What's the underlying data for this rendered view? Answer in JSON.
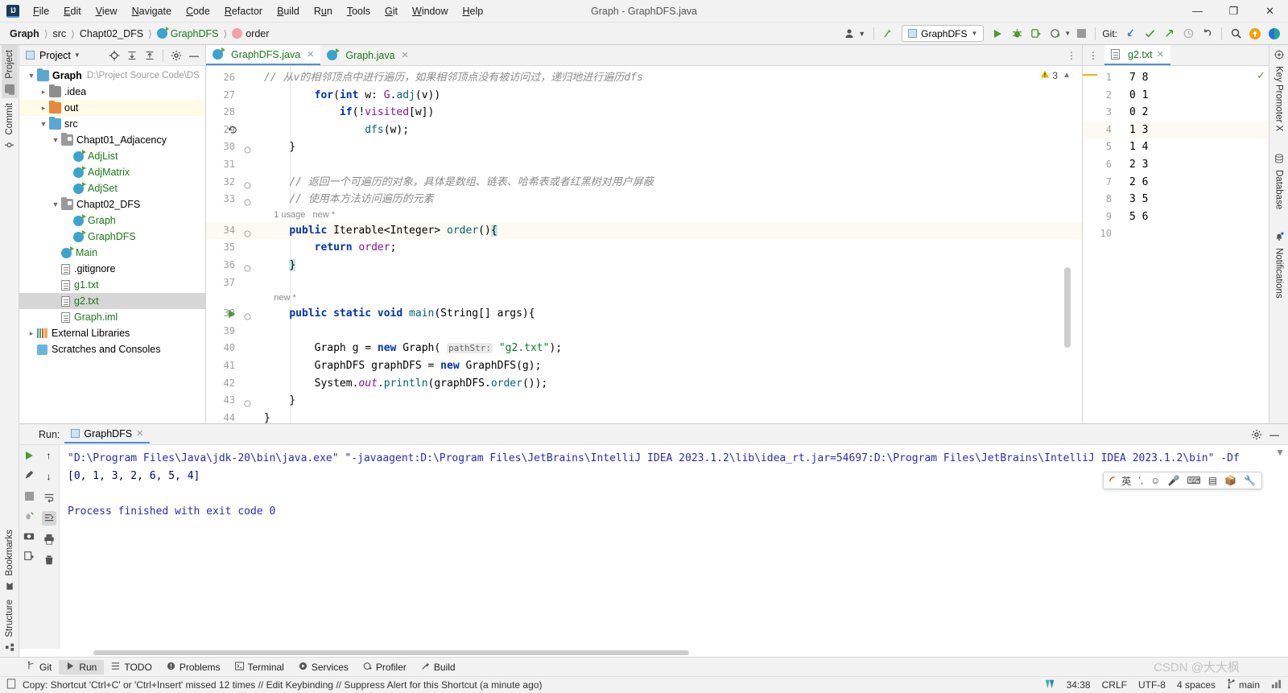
{
  "window": {
    "title": "Graph - GraphDFS.java",
    "logo": "IJ",
    "min": "—",
    "max": "❐",
    "close": "✕"
  },
  "menu": [
    "File",
    "Edit",
    "View",
    "Navigate",
    "Code",
    "Refactor",
    "Build",
    "Run",
    "Tools",
    "Git",
    "Window",
    "Help"
  ],
  "breadcrumb": [
    {
      "label": "Graph",
      "kind": "project"
    },
    {
      "label": "src",
      "kind": "dir"
    },
    {
      "label": "Chapt02_DFS",
      "kind": "dir"
    },
    {
      "label": "GraphDFS",
      "kind": "class"
    },
    {
      "label": "order",
      "kind": "method"
    }
  ],
  "toolbar": {
    "run_config": "GraphDFS",
    "git_label": "Git:",
    "icons": [
      "avatar-icon",
      "undo-arrow-icon",
      "run-icon",
      "debug-icon",
      "run-coverage-icon",
      "profile-icon",
      "stop-icon",
      "git-update-icon",
      "git-commit-icon",
      "git-push-icon",
      "git-history-icon",
      "git-rollback-icon",
      "search-everywhere-icon",
      "updates-icon",
      "ide-icon"
    ]
  },
  "left_strip": {
    "tabs": [
      "Project",
      "Commit"
    ],
    "bottom_tabs": [
      "Bookmarks",
      "Structure"
    ],
    "selected": "Project"
  },
  "right_strip": {
    "tabs": [
      "Key Promoter X",
      "Database",
      "Notifications"
    ]
  },
  "project_panel": {
    "title": "Project",
    "tree": [
      {
        "depth": 0,
        "arrow": "v",
        "icon": "folder-module",
        "label": "Graph",
        "bold": true,
        "path": "D:\\Project Source Code\\DS",
        "hl": ""
      },
      {
        "depth": 1,
        "arrow": ">",
        "icon": "folder-gray",
        "label": ".idea",
        "hl": ""
      },
      {
        "depth": 1,
        "arrow": ">",
        "icon": "folder-orange",
        "label": "out",
        "hl": "yellow"
      },
      {
        "depth": 1,
        "arrow": "v",
        "icon": "folder-src",
        "label": "src",
        "hl": ""
      },
      {
        "depth": 2,
        "arrow": "v",
        "icon": "folder-package",
        "label": "Chapt01_Adjacency",
        "hl": ""
      },
      {
        "depth": 3,
        "arrow": "",
        "icon": "class",
        "label": "AdjList",
        "green": true,
        "hl": ""
      },
      {
        "depth": 3,
        "arrow": "",
        "icon": "class",
        "label": "AdjMatrix",
        "green": true,
        "hl": ""
      },
      {
        "depth": 3,
        "arrow": "",
        "icon": "class",
        "label": "AdjSet",
        "green": true,
        "hl": ""
      },
      {
        "depth": 2,
        "arrow": "v",
        "icon": "folder-package",
        "label": "Chapt02_DFS",
        "hl": ""
      },
      {
        "depth": 3,
        "arrow": "",
        "icon": "class",
        "label": "Graph",
        "green": true,
        "hl": ""
      },
      {
        "depth": 3,
        "arrow": "",
        "icon": "class",
        "label": "GraphDFS",
        "green": true,
        "hl": ""
      },
      {
        "depth": 2,
        "arrow": "",
        "icon": "class",
        "label": "Main",
        "green": true,
        "hl": ""
      },
      {
        "depth": 2,
        "arrow": "",
        "icon": "file-gitignore",
        "label": ".gitignore",
        "hl": ""
      },
      {
        "depth": 2,
        "arrow": "",
        "icon": "file-text",
        "label": "g1.txt",
        "green": true,
        "hl": ""
      },
      {
        "depth": 2,
        "arrow": "",
        "icon": "file-text",
        "label": "g2.txt",
        "green": true,
        "hl": "gray"
      },
      {
        "depth": 2,
        "arrow": "",
        "icon": "file-iml",
        "label": "Graph.iml",
        "green": true,
        "hl": ""
      },
      {
        "depth": 0,
        "arrow": ">",
        "icon": "libraries",
        "label": "External Libraries",
        "hl": ""
      },
      {
        "depth": 0,
        "arrow": "",
        "icon": "scratches",
        "label": "Scratches and Consoles",
        "hl": ""
      }
    ]
  },
  "editor": {
    "tabs": [
      {
        "label": "GraphDFS.java",
        "active": true,
        "icon": "class-icon"
      },
      {
        "label": "Graph.java",
        "active": false,
        "icon": "class-icon"
      }
    ],
    "warning_count": "3",
    "lines": [
      {
        "n": "26",
        "type": "code",
        "clipped": true,
        "html": "<span class='cmt'>// 从v的相邻顶点中进行遍历，如果相邻顶点没有被访问过，递归地进行遍历dfs</span>"
      },
      {
        "n": "27",
        "type": "code",
        "html": "        <span class='kw'>for</span>(<span class='kw'>int</span> w: <span class='fld'>G</span>.<span class='mth'>adj</span>(v))"
      },
      {
        "n": "28",
        "type": "code",
        "html": "            <span class='kw'>if</span>(!<span class='fld'>visited</span>[w])"
      },
      {
        "n": "29",
        "type": "code",
        "gutter_icon": "recursion-icon",
        "html": "                <span class='mth'>dfs</span>(w);"
      },
      {
        "n": "30",
        "type": "code",
        "fold": true,
        "html": "    }"
      },
      {
        "n": "31",
        "type": "code",
        "html": ""
      },
      {
        "n": "32",
        "type": "code",
        "fold": true,
        "html": "    <span class='cmt'>// 返回一个可遍历的对象，具体是数组、链表、哈希表或者红黑树对用户屏蔽</span>"
      },
      {
        "n": "33",
        "type": "code",
        "fold": true,
        "html": "    <span class='cmt'>// 使用本方法访问遍历的元素</span>"
      },
      {
        "n": "",
        "type": "hint",
        "text": "1 usage   new *"
      },
      {
        "n": "34",
        "type": "code",
        "hl": true,
        "fold": true,
        "html": "    <span class='kw'>public</span> <span class='typ'>Iterable</span>&lt;<span class='typ'>Integer</span>&gt; <span class='mth'>order</span>()<span class='hlbrace'>{</span>"
      },
      {
        "n": "35",
        "type": "code",
        "html": "        <span class='kw'>return</span> <span class='fld'>order</span>;"
      },
      {
        "n": "36",
        "type": "code",
        "fold": true,
        "html": "    <span class='hlbrace'>}</span>"
      },
      {
        "n": "37",
        "type": "code",
        "html": ""
      },
      {
        "n": "",
        "type": "hint",
        "text": "new *"
      },
      {
        "n": "38",
        "type": "code",
        "gutter_icon": "run-gutter-icon",
        "fold": true,
        "html": "    <span class='kw'>public static</span> <span class='kw'>void</span> <span class='mth'>main</span>(<span class='typ'>String</span>[] args){"
      },
      {
        "n": "39",
        "type": "code",
        "html": ""
      },
      {
        "n": "40",
        "type": "code",
        "html": "        <span class='typ'>Graph</span> g = <span class='kw'>new</span> <span class='typ'>Graph</span>( <span class='param-hint'>pathStr:</span> <span class='str'>\"g2.txt\"</span>);"
      },
      {
        "n": "41",
        "type": "code",
        "html": "        <span class='typ'>GraphDFS</span> graphDFS = <span class='kw'>new</span> <span class='typ'>GraphDFS</span>(g);"
      },
      {
        "n": "42",
        "type": "code",
        "html": "        <span class='typ'>System</span>.<span class='sfld'>out</span>.<span class='mth'>println</span>(graphDFS.<span class='mth'>order</span>());"
      },
      {
        "n": "43",
        "type": "code",
        "fold": true,
        "html": "    }"
      },
      {
        "n": "44",
        "type": "code",
        "html": "}"
      }
    ]
  },
  "right_editor": {
    "tab": "g2.txt",
    "lines": [
      {
        "n": "1",
        "text": "7 8"
      },
      {
        "n": "2",
        "text": "0 1"
      },
      {
        "n": "3",
        "text": "0 2"
      },
      {
        "n": "4",
        "text": "1 3",
        "hl": true
      },
      {
        "n": "5",
        "text": "1 4"
      },
      {
        "n": "6",
        "text": "2 3"
      },
      {
        "n": "7",
        "text": "2 6"
      },
      {
        "n": "8",
        "text": "3 5"
      },
      {
        "n": "9",
        "text": "5 6"
      },
      {
        "n": "10",
        "text": ""
      }
    ]
  },
  "run_panel": {
    "label": "Run:",
    "tab": "GraphDFS",
    "console": [
      {
        "text": "\"D:\\Program Files\\Java\\jdk-20\\bin\\java.exe\" \"-javaagent:D:\\Program Files\\JetBrains\\IntelliJ IDEA 2023.1.2\\lib\\idea_rt.jar=54697:D:\\Program Files\\JetBrains\\IntelliJ IDEA 2023.1.2\\bin\" -Df",
        "kind": "cmd"
      },
      {
        "text": "[0, 1, 3, 2, 6, 5, 4]",
        "kind": "out"
      },
      {
        "text": "",
        "kind": "out"
      },
      {
        "text": "Process finished with exit code 0",
        "kind": "fin"
      }
    ]
  },
  "bottom_bar": {
    "items": [
      {
        "label": "Git",
        "icon": "git-branch-icon",
        "sel": false
      },
      {
        "label": "Run",
        "icon": "run-icon",
        "sel": true
      },
      {
        "label": "TODO",
        "icon": "todo-icon",
        "sel": false
      },
      {
        "label": "Problems",
        "icon": "problems-icon",
        "sel": false
      },
      {
        "label": "Terminal",
        "icon": "terminal-icon",
        "sel": false
      },
      {
        "label": "Services",
        "icon": "services-icon",
        "sel": false
      },
      {
        "label": "Profiler",
        "icon": "profiler-icon",
        "sel": false
      },
      {
        "label": "Build",
        "icon": "build-icon",
        "sel": false
      }
    ]
  },
  "status_bar": {
    "message": "Copy: Shortcut 'Ctrl+C' or 'Ctrl+Insert' missed 12 times // Edit Keybinding // Suppress Alert for this Shortcut (a minute ago)",
    "position": "34:38",
    "line_sep": "CRLF",
    "encoding": "UTF-8",
    "indent": "4 spaces",
    "branch": "main"
  },
  "ime": {
    "lang": "英",
    "items": [
      "sogou-logo",
      "lang-toggle",
      "punct-icon",
      "emoji-icon",
      "mic-icon",
      "keyboard-icon",
      "tools-icon",
      "box-icon",
      "wrench-icon"
    ]
  },
  "watermark": "CSDN @大大枫",
  "colors": {
    "accent": "#4a90d9",
    "green": "#1a7a1a",
    "keyword": "#0033b3",
    "string": "#067d17",
    "warn": "#e8b800"
  }
}
